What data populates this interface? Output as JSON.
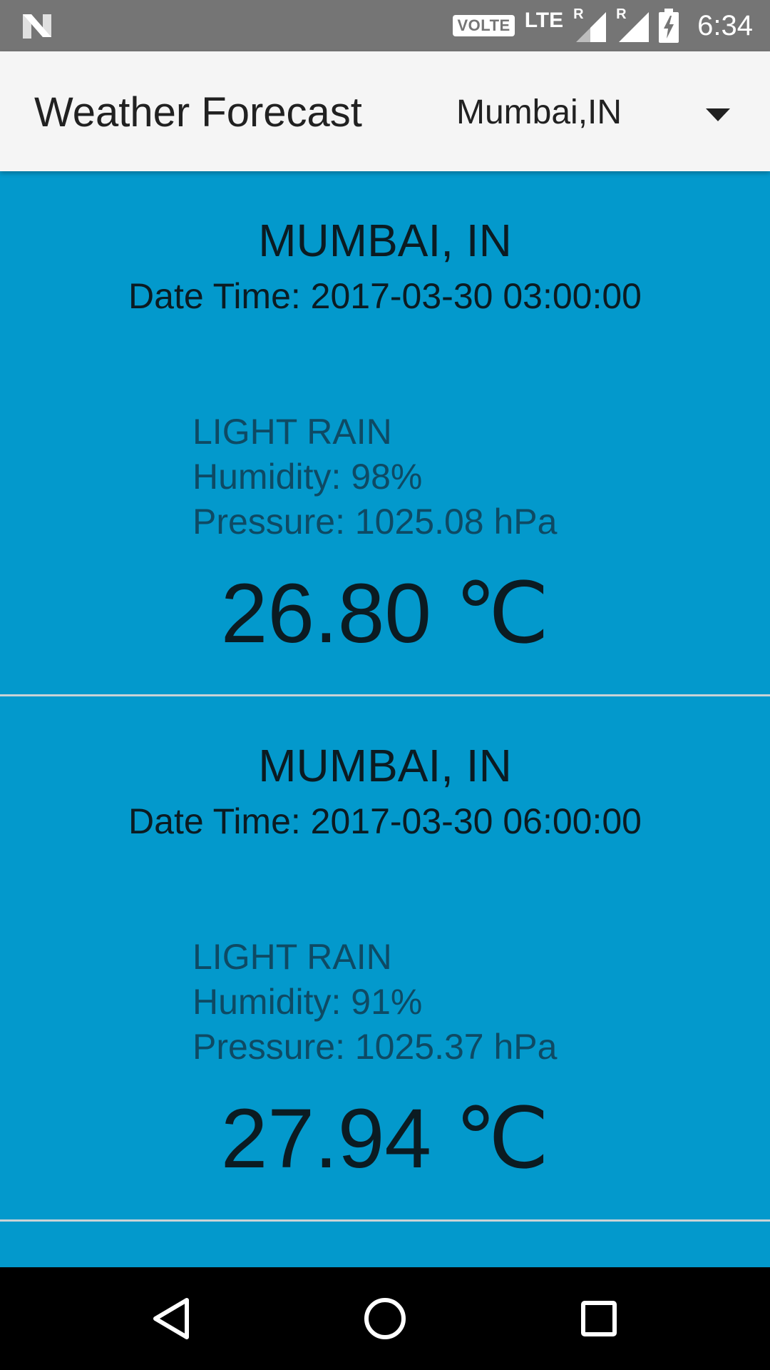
{
  "status_bar": {
    "volte": "VOLTE",
    "network": "LTE",
    "roaming_1": "R",
    "roaming_2": "R",
    "time": "6:34"
  },
  "app_bar": {
    "title": "Weather Forecast",
    "city_selected": "Mumbai,IN"
  },
  "forecasts": [
    {
      "city": "MUMBAI, IN",
      "datetime": "Date Time: 2017-03-30 03:00:00",
      "condition": "LIGHT RAIN",
      "humidity": "Humidity: 98%",
      "pressure": "Pressure: 1025.08 hPa",
      "temperature": "26.80 ℃"
    },
    {
      "city": "MUMBAI, IN",
      "datetime": "Date Time: 2017-03-30 06:00:00",
      "condition": "LIGHT RAIN",
      "humidity": "Humidity: 91%",
      "pressure": "Pressure: 1025.37 hPa",
      "temperature": "27.94 ℃"
    }
  ],
  "colors": {
    "card_background": "#0399cc",
    "status_bar": "#757575",
    "app_bar": "#f5f5f5",
    "nav_bar": "#000000"
  },
  "icons": [
    "n-logo-icon",
    "signal-icon",
    "battery-charging-icon",
    "dropdown-caret-icon",
    "back-icon",
    "home-icon",
    "recents-icon"
  ]
}
